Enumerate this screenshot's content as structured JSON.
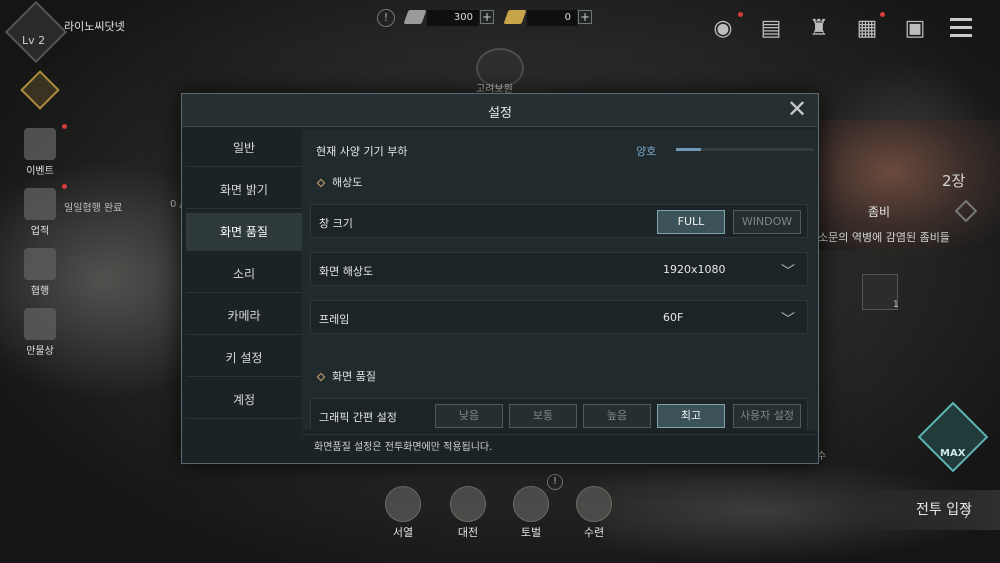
{
  "player": {
    "name": "라이노씨닷넷",
    "level": "Lv 2"
  },
  "currency": {
    "silver": "300",
    "gold": "0",
    "alert": "!",
    "plus": "+"
  },
  "left_menu": {
    "items": [
      "이벤트",
      "업적",
      "협행",
      "만물상"
    ],
    "quest_label": "일일협행 완료",
    "quest_value": "0 /"
  },
  "location": {
    "name": "고려보원"
  },
  "right_panel": {
    "count": "2장",
    "monster_name": "좀비",
    "monster_desc": "소문의 역병에 감염된 좀비들",
    "reward_count": "1",
    "side_text": "수",
    "mask_label": "MAX",
    "battle_button": "전투 입장",
    "battle_arrow": "〉"
  },
  "bottom_nav": {
    "items": [
      "서열",
      "대전",
      "토벌",
      "수련"
    ],
    "alert": "!"
  },
  "settings": {
    "title": "설정",
    "close": "✕",
    "tabs": [
      "일반",
      "화면 밝기",
      "화면 품질",
      "소리",
      "카메라",
      "키 설정",
      "계정"
    ],
    "active_tab": "화면 품질",
    "device_load": {
      "label": "현재 사양 기기 부하",
      "value": "양호",
      "level_percent": 18
    },
    "resolution_section": "해상도",
    "window_size": {
      "label": "창 크기",
      "options": [
        "FULL",
        "WINDOW"
      ],
      "selected": "FULL"
    },
    "screen_resolution": {
      "label": "화면 해상도",
      "value": "1920x1080",
      "chevron": "﹀"
    },
    "frame": {
      "label": "프레임",
      "value": "60F",
      "chevron": "﹀"
    },
    "quality_section": "화면 품질",
    "graphics_preset": {
      "label": "그래픽 간편 설정",
      "options": [
        "낮음",
        "보통",
        "높음",
        "최고",
        "사용자 설정"
      ],
      "selected": "최고"
    },
    "footer_note": "화면품질 설정은 전투화면에만 적용됩니다."
  }
}
